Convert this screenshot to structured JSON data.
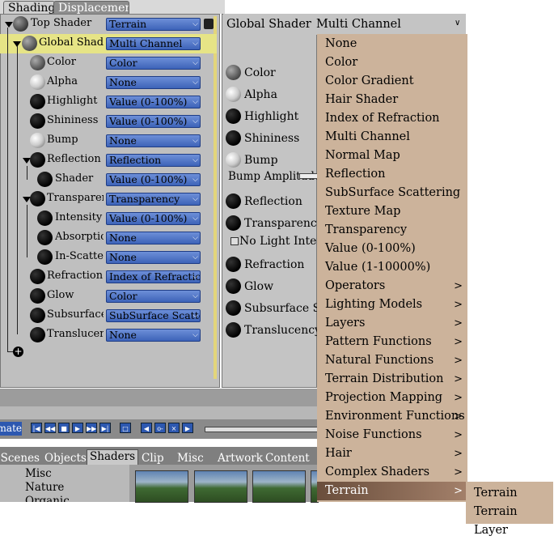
{
  "tabs": [
    "Shading",
    "Displacement"
  ],
  "tree_rows": [
    {
      "label": "Top Shader",
      "value": "Terrain"
    },
    {
      "label": "Global Shader",
      "value": "Multi Channel"
    },
    {
      "label": "Color",
      "value": "Color"
    },
    {
      "label": "Alpha",
      "value": "None"
    },
    {
      "label": "Highlight",
      "value": "Value (0-100%)"
    },
    {
      "label": "Shininess",
      "value": "Value (0-100%)"
    },
    {
      "label": "Bump",
      "value": "None"
    },
    {
      "label": "Reflection",
      "value": "Reflection"
    },
    {
      "label": "Shader",
      "value": "Value (0-100%)"
    },
    {
      "label": "Transparency",
      "value": "Transparency"
    },
    {
      "label": "Intensity",
      "value": "Value (0-100%)"
    },
    {
      "label": "Absorption",
      "value": "None"
    },
    {
      "label": "In-Scatter",
      "value": "None"
    },
    {
      "label": "Refraction",
      "value": "Index of Refraction"
    },
    {
      "label": "Glow",
      "value": "Color"
    },
    {
      "label": "Subsurface",
      "value": "SubSurface Scattering"
    },
    {
      "label": "Translucency",
      "value": "None"
    }
  ],
  "global_shader": {
    "label": "Global Shader",
    "value": "Multi Channel"
  },
  "channels": [
    "Color",
    "Alpha",
    "Highlight",
    "Shininess",
    "Bump",
    "Bump Amplitude",
    "Reflection",
    "Transparency",
    "No Light Interaction",
    "Refraction",
    "Glow",
    "Subsurface Scattering",
    "Translucency"
  ],
  "menu_items": [
    {
      "label": "None",
      "sub": ""
    },
    {
      "label": "Color",
      "sub": ""
    },
    {
      "label": "Color Gradient",
      "sub": ""
    },
    {
      "label": "Hair Shader",
      "sub": ""
    },
    {
      "label": "Index of Refraction",
      "sub": ""
    },
    {
      "label": "Multi Channel",
      "sub": ""
    },
    {
      "label": "Normal Map",
      "sub": ""
    },
    {
      "label": "Reflection",
      "sub": ""
    },
    {
      "label": "SubSurface Scattering",
      "sub": ""
    },
    {
      "label": "Texture Map",
      "sub": ""
    },
    {
      "label": "Transparency",
      "sub": ""
    },
    {
      "label": "Value (0-100%)",
      "sub": ""
    },
    {
      "label": "Value (1-10000%)",
      "sub": ""
    },
    {
      "label": "Operators",
      "sub": ">"
    },
    {
      "label": "Lighting Models",
      "sub": ">"
    },
    {
      "label": "Layers",
      "sub": ">"
    },
    {
      "label": "Pattern Functions",
      "sub": ">"
    },
    {
      "label": "Natural Functions",
      "sub": ">"
    },
    {
      "label": "Terrain Distribution",
      "sub": ">"
    },
    {
      "label": "Projection Mapping",
      "sub": ">"
    },
    {
      "label": "Environment Functions",
      "sub": ">"
    },
    {
      "label": "Noise Functions",
      "sub": ">"
    },
    {
      "label": "Hair",
      "sub": ">"
    },
    {
      "label": "Complex Shaders",
      "sub": ">"
    },
    {
      "label": "Terrain",
      "sub": ">"
    }
  ],
  "submenu_items": [
    "Terrain",
    "Terrain Layer"
  ],
  "timeline_label": "Animate",
  "bottom_tabs": [
    "Scenes",
    "Objects",
    "Shaders",
    "Clip",
    "Misc",
    "Artwork",
    "Content"
  ],
  "library_items": [
    "Misc",
    "Nature",
    "Organic"
  ],
  "colors": {
    "accent": "#3d63b8",
    "menu": "#ccb39b",
    "selection": "#e6e486"
  }
}
